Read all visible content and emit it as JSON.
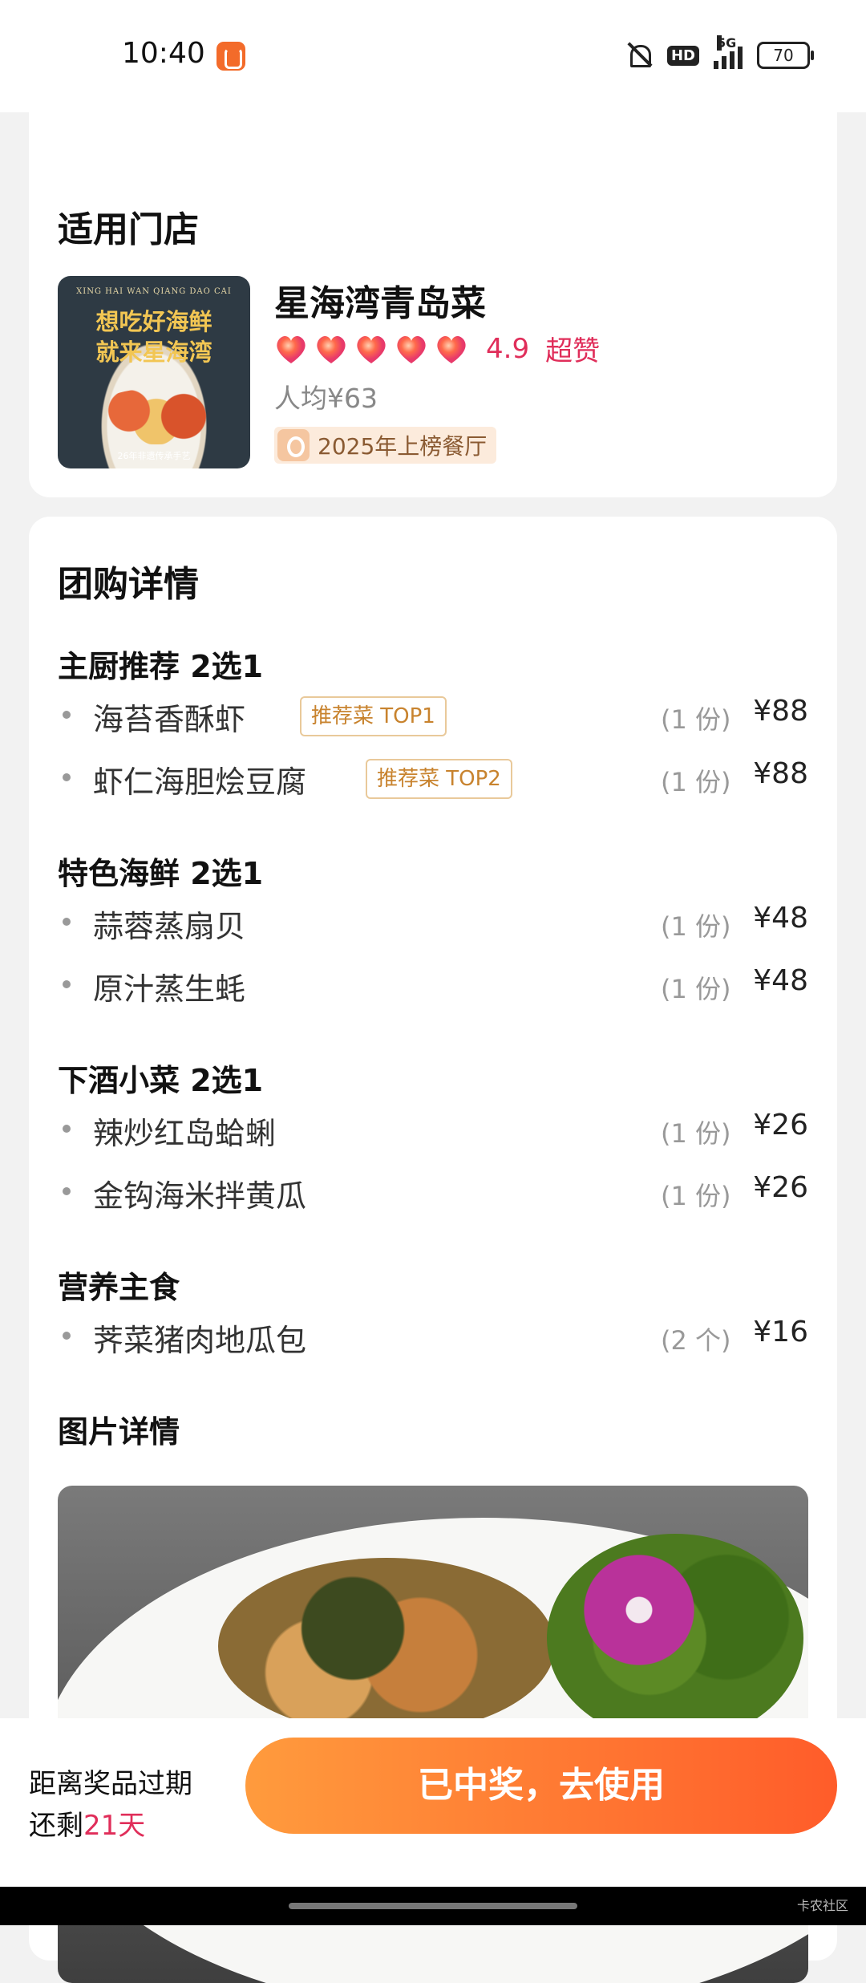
{
  "status_bar": {
    "time": "10:40",
    "signal": "5G",
    "battery": "70"
  },
  "store_section": {
    "title": "适用门店",
    "image": {
      "small_text": "XING HAI WAN QIANG DAO CAI",
      "line1": "想吃好海鲜",
      "line2": "就来星海湾",
      "caption": "26年非遗传承手艺"
    },
    "name": "星海湾青岛菜",
    "rating_hearts": 5,
    "rating": "4.9",
    "rating_label": "超赞",
    "avg_price": "人均¥63",
    "rank_badge": "2025年上榜餐厅"
  },
  "deal_section": {
    "title": "团购详情",
    "groups": [
      {
        "title": "主厨推荐 2选1",
        "items": [
          {
            "name": "海苔香酥虾",
            "tag": "推荐菜 TOP1",
            "qty": "(1 份)",
            "price": "¥88"
          },
          {
            "name": "虾仁海胆烩豆腐",
            "tag": "推荐菜 TOP2",
            "qty": "(1 份)",
            "price": "¥88"
          }
        ]
      },
      {
        "title": "特色海鲜 2选1",
        "items": [
          {
            "name": "蒜蓉蒸扇贝",
            "qty": "(1 份)",
            "price": "¥48"
          },
          {
            "name": "原汁蒸生蚝",
            "qty": "(1 份)",
            "price": "¥48"
          }
        ]
      },
      {
        "title": "下酒小菜 2选1",
        "items": [
          {
            "name": "辣炒红岛蛤蜊",
            "qty": "(1 份)",
            "price": "¥26"
          },
          {
            "name": "金钩海米拌黄瓜",
            "qty": "(1 份)",
            "price": "¥26"
          }
        ]
      },
      {
        "title": "营养主食",
        "items": [
          {
            "name": "荠菜猪肉地瓜包",
            "qty": "(2 个)",
            "price": "¥16"
          }
        ]
      }
    ],
    "photo_title": "图片详情"
  },
  "bottom_bar": {
    "expire_line1": "距离奖品过期",
    "expire_prefix": "还剩",
    "expire_days": "21天",
    "button_label": "已中奖，去使用"
  },
  "watermark": "卡农社区",
  "colors": {
    "accent": "#ff5c2a",
    "rating": "#e02e5a",
    "tag_text": "#c8832e",
    "tag_border": "#e9c99a"
  }
}
